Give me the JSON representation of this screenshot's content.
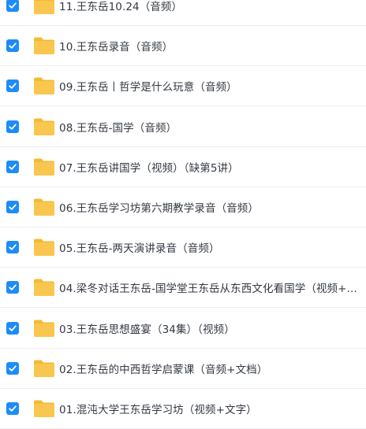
{
  "accent_color": "#1d8cf8",
  "folder_color": "#f9c74f",
  "files": [
    {
      "name": "11.王东岳10.24（音频）",
      "checked": true,
      "icon": "folder-icon"
    },
    {
      "name": "10.王东岳录音（音频）",
      "checked": true,
      "icon": "folder-icon"
    },
    {
      "name": "09.王东岳丨哲学是什么玩意（音频）",
      "checked": true,
      "icon": "folder-icon"
    },
    {
      "name": "08.王东岳-国学（音频）",
      "checked": true,
      "icon": "folder-icon"
    },
    {
      "name": "07.王东岳讲国学（视频）（缺第5讲）",
      "checked": true,
      "icon": "folder-icon"
    },
    {
      "name": "06.王东岳学习坊第六期教学录音（音频）",
      "checked": true,
      "icon": "folder-icon"
    },
    {
      "name": "05.王东岳-两天演讲录音（音频）",
      "checked": true,
      "icon": "folder-icon"
    },
    {
      "name": "04.梁冬对话王东岳-国学堂王东岳从东西文化看国学（视频+...",
      "checked": true,
      "icon": "folder-icon"
    },
    {
      "name": "03.王东岳思想盛宴（34集）（视频）",
      "checked": true,
      "icon": "folder-icon"
    },
    {
      "name": "02.王东岳的中西哲学启蒙课（音频+文档）",
      "checked": true,
      "icon": "folder-icon"
    },
    {
      "name": "01.混沌大学王东岳学习坊（视频+文字）",
      "checked": true,
      "icon": "folder-icon"
    }
  ]
}
